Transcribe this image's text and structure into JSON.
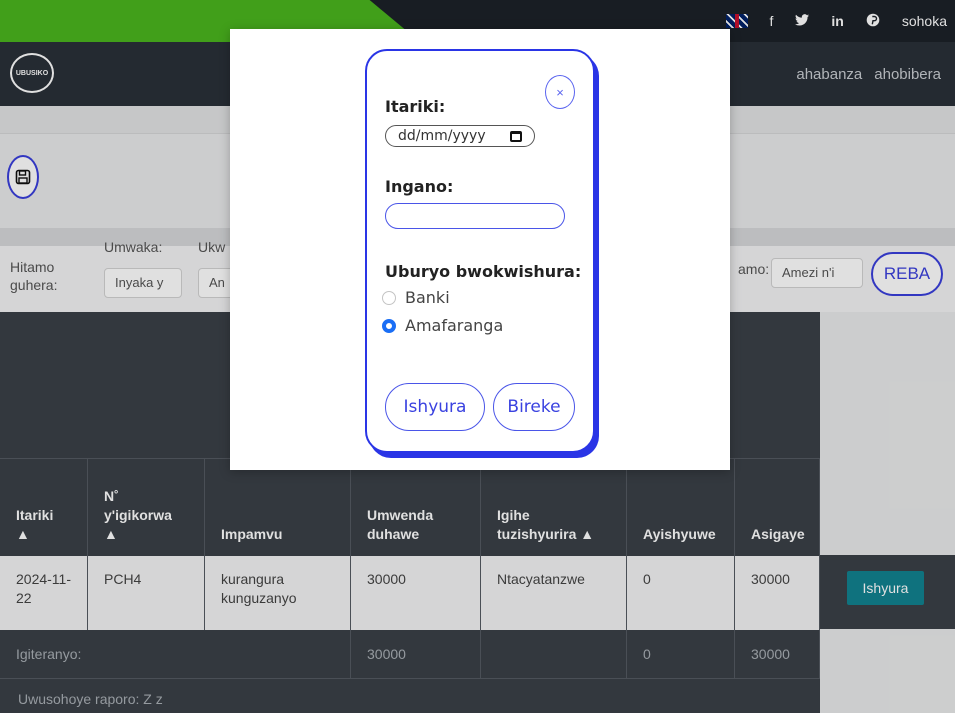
{
  "topbar": {
    "social": [
      "f",
      "t",
      "in",
      "p"
    ],
    "signout_label": "sohoka"
  },
  "nav": {
    "logo_text": "UBUSIKO",
    "links": [
      "ahabanza",
      "ahobibera"
    ]
  },
  "filters": {
    "label_main": "Hitamo guhera:",
    "year_label": "Umwaka:",
    "year_placeholder": "Inyaka y",
    "month_label": "Ukw",
    "month_placeholder": "An",
    "end_label": "amo:",
    "end_placeholder": "Amezi n'i",
    "view_button": "REBA"
  },
  "table": {
    "headers": [
      "Itariki ▲",
      "N˚ y'igikorwa ▲",
      "Impamvu",
      "Umwenda duhawe",
      "Igihe tuzishyurira ▲",
      "Ayishyuwe",
      "Asigaye"
    ],
    "rows": [
      {
        "date": "2024-11-22",
        "ref": "PCH4",
        "reason": "kurangura kunguzanyo",
        "amount": "30000",
        "due": "Ntacyatanzwe",
        "paid": "0",
        "balance": "30000",
        "action": "Ishyura"
      }
    ],
    "totals": {
      "label": "Igiteranyo:",
      "amount": "30000",
      "paid": "0",
      "balance": "30000"
    },
    "footer": "Uwusohoye raporo: Z z"
  },
  "modal": {
    "date_label": "Itariki:",
    "date_placeholder": "dd/mm/yyyy",
    "amount_label": "Ingano:",
    "amount_value": "",
    "method_label": "Uburyo bwokwishura:",
    "methods": [
      {
        "label": "Banki",
        "selected": false
      },
      {
        "label": "Amafaranga",
        "selected": true
      }
    ],
    "pay_button": "Ishyura",
    "cancel_button": "Bireke",
    "close_symbol": "×"
  },
  "colors": {
    "accent": "#2a35e6",
    "brand_green": "#4bb51e",
    "action_teal": "#128290",
    "dark": "#3b4047"
  }
}
